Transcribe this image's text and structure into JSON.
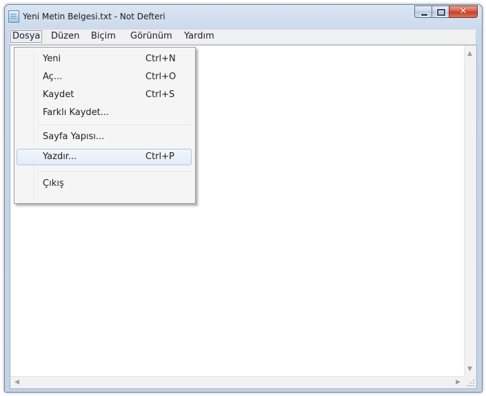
{
  "window": {
    "title": "Yeni Metin Belgesi.txt - Not Defteri",
    "minimize": "minimize",
    "maximize": "maximize",
    "close": "✕"
  },
  "menubar": {
    "items": [
      "Dosya",
      "Düzen",
      "Biçim",
      "Görünüm",
      "Yardım"
    ],
    "active": "Dosya"
  },
  "file_menu": {
    "items": [
      {
        "label": "Yeni",
        "shortcut": "Ctrl+N"
      },
      {
        "label": "Aç...",
        "shortcut": "Ctrl+O"
      },
      {
        "label": "Kaydet",
        "shortcut": "Ctrl+S"
      },
      {
        "label": "Farklı Kaydet...",
        "shortcut": ""
      },
      {
        "label": "Sayfa Yapısı...",
        "shortcut": ""
      },
      {
        "label": "Yazdır...",
        "shortcut": "Ctrl+P"
      },
      {
        "label": "Çıkış",
        "shortcut": ""
      }
    ],
    "highlighted": "Yazdır..."
  },
  "editor": {
    "content": ""
  },
  "icons": {
    "app": "notepad-icon",
    "scroll_up": "scroll-up-arrow-icon",
    "scroll_down": "scroll-down-arrow-icon",
    "scroll_left": "scroll-left-arrow-icon",
    "scroll_right": "scroll-right-arrow-icon",
    "grip": "resize-grip-icon"
  },
  "colors": {
    "titlebar": "#dbe6f3",
    "close_button": "#c43e24",
    "menu_highlight": "#a8c6e8"
  }
}
